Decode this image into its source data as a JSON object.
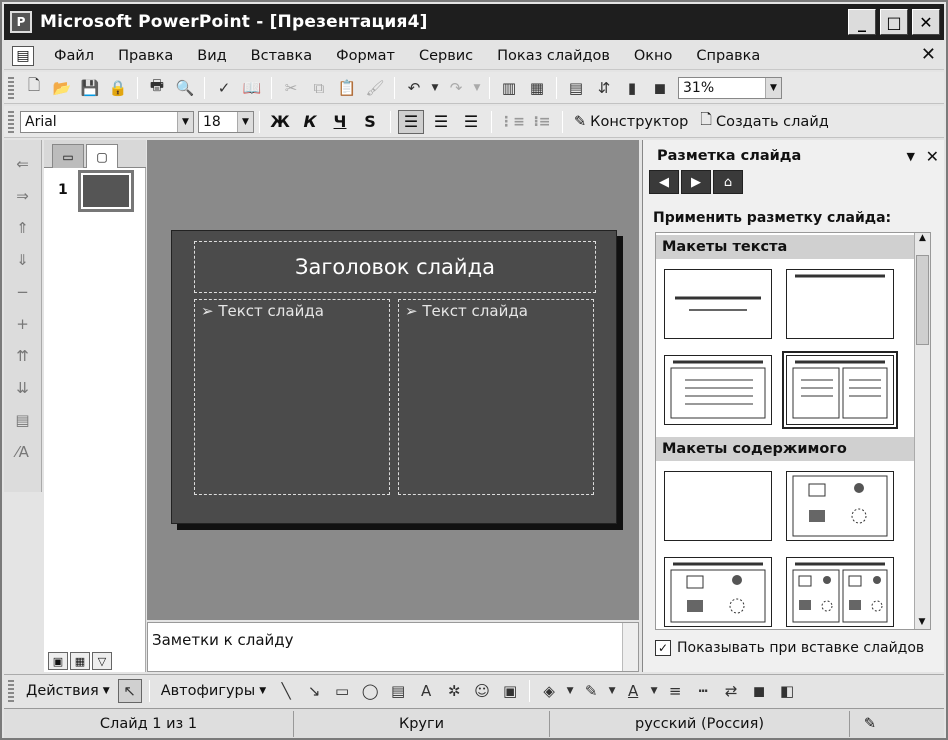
{
  "window": {
    "title": "Microsoft PowerPoint - [Презентация4]",
    "app_icon": "powerpoint-icon"
  },
  "menu": {
    "items": [
      "Файл",
      "Правка",
      "Вид",
      "Вставка",
      "Формат",
      "Сервис",
      "Показ слайдов",
      "Окно",
      "Справка"
    ]
  },
  "standard_toolbar": {
    "zoom": "31%"
  },
  "formatting_toolbar": {
    "font": "Arial",
    "size": "18",
    "bold": "Ж",
    "italic": "К",
    "underline": "Ч",
    "shadow": "S",
    "designer": "Конструктор",
    "new_slide": "Создать слайд"
  },
  "thumbnails": {
    "slide_number": "1"
  },
  "slide": {
    "title": "Заголовок слайда",
    "left_text": "Текст слайда",
    "right_text": "Текст слайда"
  },
  "notes": {
    "placeholder": "Заметки к слайду"
  },
  "task_pane": {
    "title": "Разметка слайда",
    "apply_label": "Применить разметку слайда:",
    "section_text": "Макеты текста",
    "section_content": "Макеты содержимого",
    "show_on_insert": "Показывать при вставке слайдов"
  },
  "drawing_toolbar": {
    "actions": "Действия",
    "autoshapes": "Автофигуры"
  },
  "status": {
    "slide_info": "Слайд 1 из 1",
    "design": "Круги",
    "language": "русский (Россия)"
  }
}
